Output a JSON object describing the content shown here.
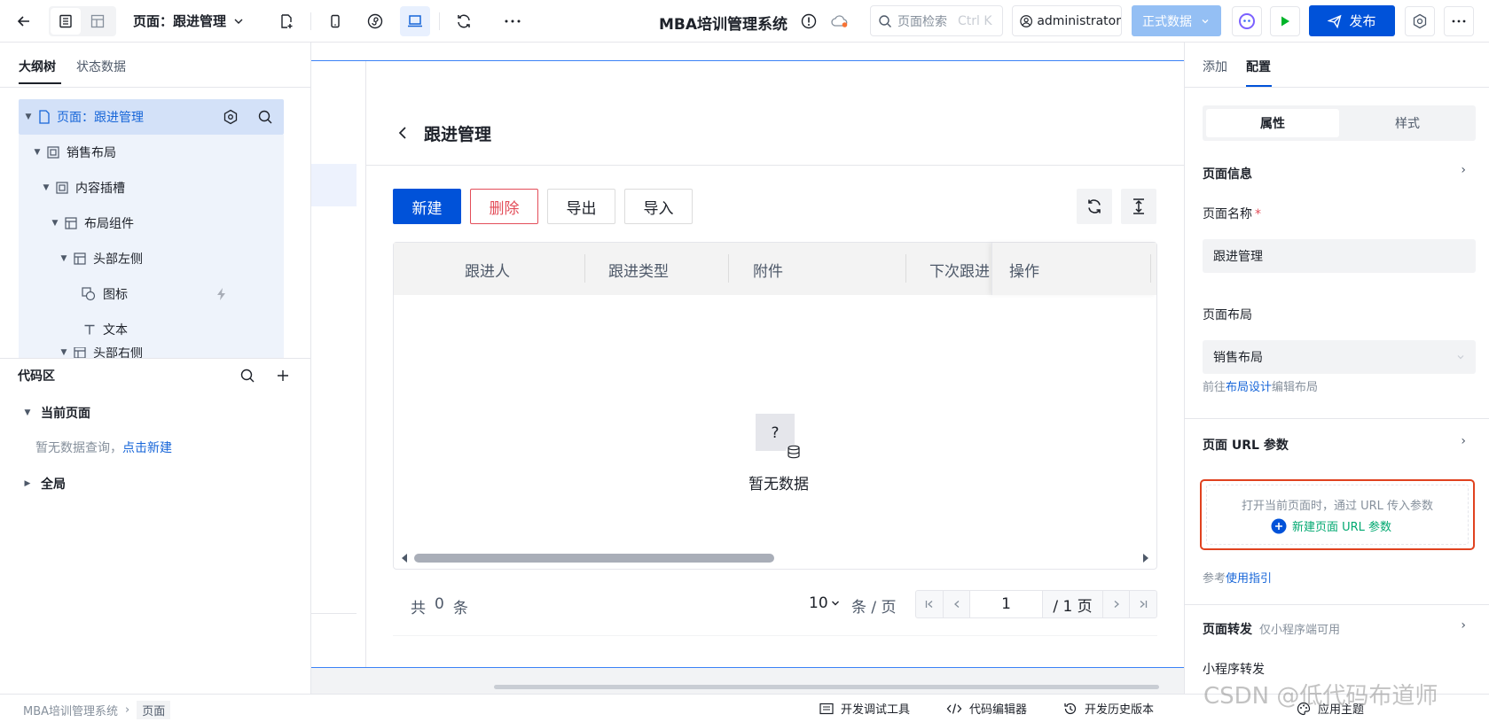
{
  "topbar": {
    "page_selector": "页面：跟进管理",
    "app_title": "MBA培训管理系统",
    "search_placeholder": "页面检索",
    "search_shortcut": "Ctrl K",
    "user": "administrator",
    "env": "正式数据",
    "publish": "发布"
  },
  "left": {
    "tab_outline": "大纲树",
    "tab_state": "状态数据",
    "tree": [
      {
        "label": "页面：跟进管理",
        "icon": "page-icon"
      },
      {
        "label": "销售布局",
        "icon": "layout-icon"
      },
      {
        "label": "内容插槽",
        "icon": "slot-icon"
      },
      {
        "label": "布局组件",
        "icon": "grid-icon"
      },
      {
        "label": "头部左侧",
        "icon": "grid-icon"
      },
      {
        "label": "图标",
        "icon": "shapes-icon"
      },
      {
        "label": "文本",
        "icon": "text-icon"
      },
      {
        "label": "头部右侧",
        "icon": "grid-icon"
      }
    ],
    "code_title": "代码区",
    "current_page": "当前页面",
    "no_query": "暂无数据查询，",
    "click_new": "点击新建",
    "global": "全局"
  },
  "canvas": {
    "page_title": "跟进管理",
    "buttons": {
      "new": "新建",
      "delete": "删除",
      "export": "导出",
      "import": "导入"
    },
    "columns": [
      "跟进人",
      "跟进类型",
      "附件",
      "下次跟进",
      "操作"
    ],
    "empty_text": "暂无数据",
    "empty_glyph": "?",
    "total_prefix": "共",
    "total_count": "0",
    "total_suffix": "条",
    "page_size": "10",
    "per_page": "条 / 页",
    "current_page": "1",
    "total_pages": "/ 1 页"
  },
  "right": {
    "tab_add": "添加",
    "tab_config": "配置",
    "seg_props": "属性",
    "seg_style": "样式",
    "page_info": "页面信息",
    "page_name_label": "页面名称",
    "required_mark": "*",
    "page_name_value": "跟进管理",
    "layout_label": "页面布局",
    "layout_value": "销售布局",
    "goto_prefix": "前往",
    "goto_link": "布局设计",
    "goto_suffix": "编辑布局",
    "url_param_title": "页面 URL 参数",
    "url_hint": "打开当前页面时，通过 URL 传入参数",
    "new_url_param": "新建页面 URL 参数",
    "ref_prefix": "参考",
    "ref_link": "使用指引",
    "forward_title": "页面转发",
    "forward_note": "仅小程序端可用",
    "mini_forward": "小程序转发"
  },
  "bottom": {
    "crumb_app": "MBA培训管理系统",
    "crumb_page": "页面",
    "dev_tools": "开发调试工具",
    "code_editor": "代码编辑器",
    "history": "开发历史版本",
    "theme": "应用主题",
    "watermark": "CSDN @低代码布道师"
  }
}
